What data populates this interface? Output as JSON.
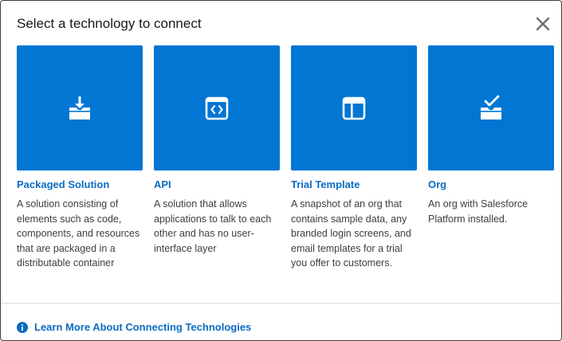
{
  "modal": {
    "title": "Select a technology to connect",
    "close_icon": "close-icon"
  },
  "cards": [
    {
      "title": "Packaged Solution",
      "description": "A solution consisting of elements such as code, components, and resources that are packaged in a distributable container",
      "icon": "download-tray-icon"
    },
    {
      "title": "API",
      "description": "A solution that allows applications to talk to each other and has no user-interface layer",
      "icon": "code-window-icon"
    },
    {
      "title": "Trial Template",
      "description": "A snapshot of an org that contains sample data, any branded login screens, and email templates for a trial you offer to customers.",
      "icon": "layout-template-icon"
    },
    {
      "title": "Org",
      "description": "An org with Salesforce Platform installed.",
      "icon": "check-tray-icon"
    }
  ],
  "footer": {
    "link_label": "Learn More About Connecting Technologies",
    "icon": "info-icon"
  },
  "colors": {
    "tile_blue": "#0176d3",
    "link_blue": "#0b6cc1",
    "divider": "#dddbda"
  }
}
